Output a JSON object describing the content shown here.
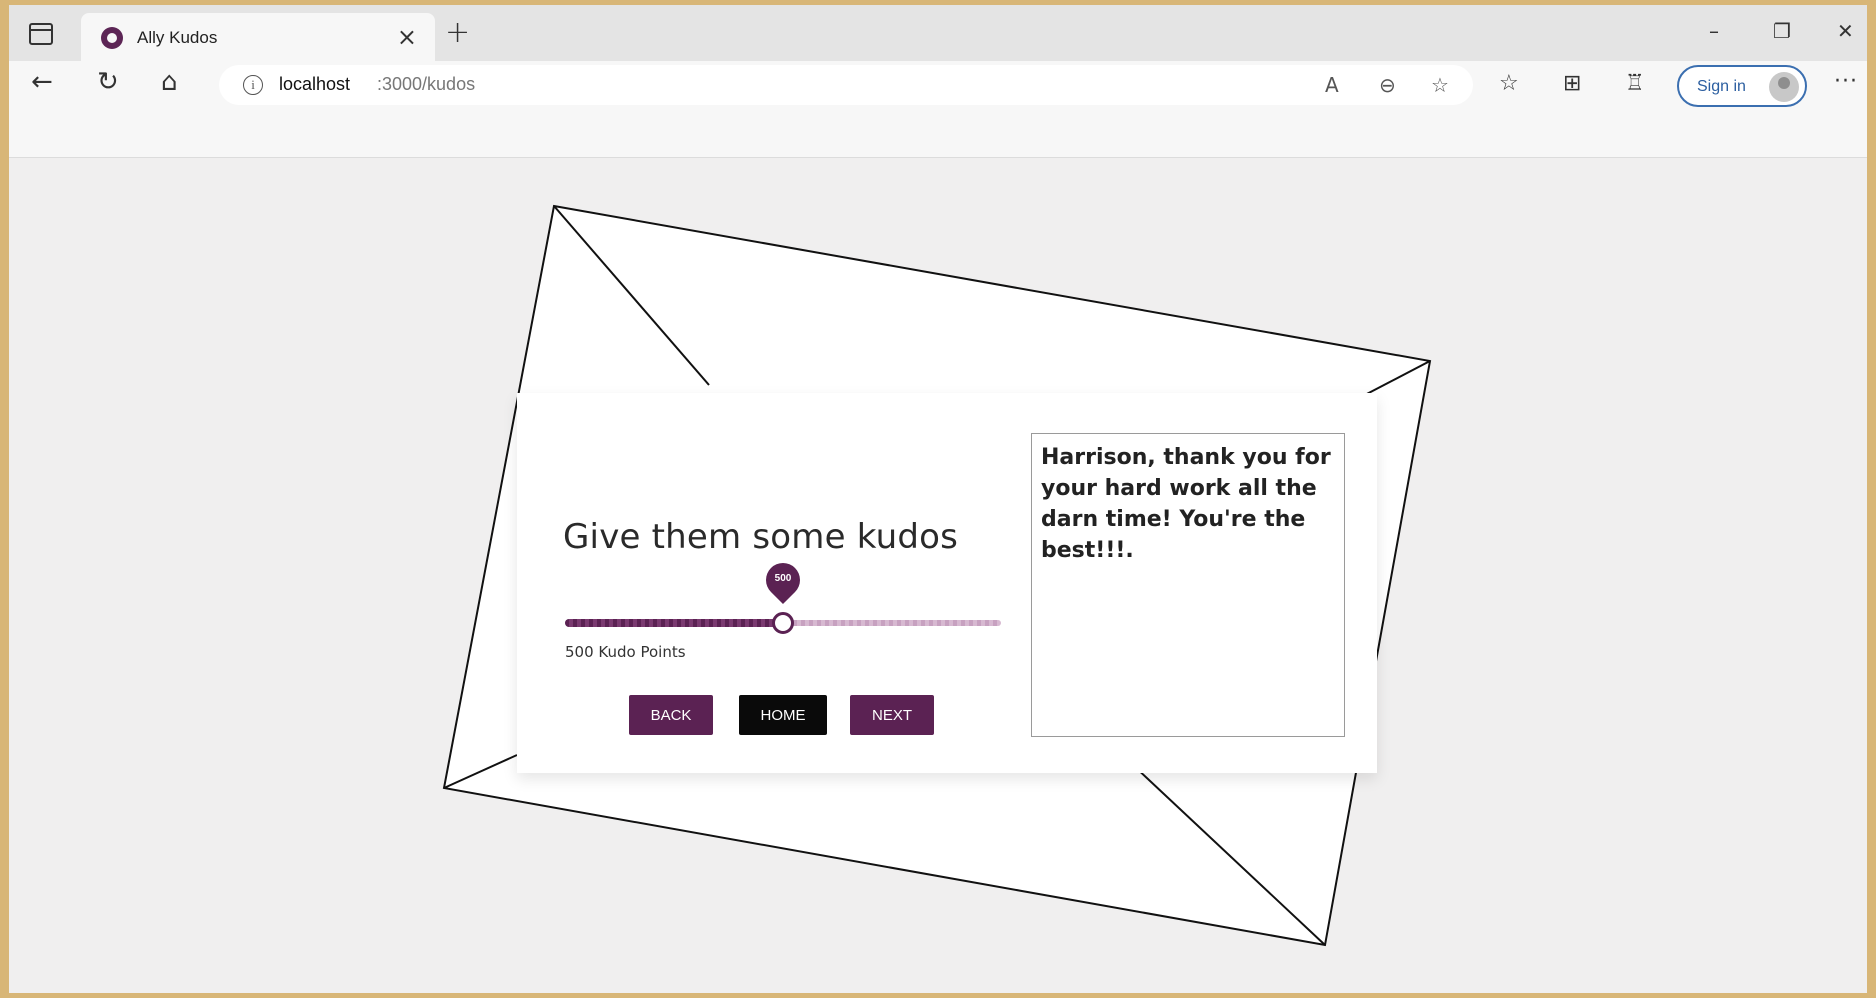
{
  "browser": {
    "tab": {
      "title": "Ally Kudos",
      "close_glyph": "×",
      "favicon": "ally-logo-icon"
    },
    "new_tab_glyph": "+",
    "window_controls": {
      "minimize": "–",
      "restore": "❐",
      "close": "✕"
    },
    "nav": {
      "back": "←",
      "refresh": "↻",
      "home": "⌂"
    },
    "address": {
      "host": "localhost",
      "path": ":3000/kudos",
      "info_glyph": "i"
    },
    "address_icons": {
      "read_aloud": "A",
      "zoom": "⊖",
      "add_favorite": "☆"
    },
    "toolbar_icons": {
      "favorites": "☆",
      "collections": "⊞",
      "extensions": "♖"
    },
    "signin_label": "Sign in",
    "more_glyph": "···"
  },
  "kudos": {
    "heading": "Give them some kudos",
    "slider": {
      "value": 500,
      "min": 0,
      "max": 1000,
      "bubble_label": "500"
    },
    "points_label": "500 Kudo Points",
    "buttons": {
      "back": "BACK",
      "home": "HOME",
      "next": "NEXT"
    },
    "message": "Harrison, thank you for your hard work all the darn time! You're the best!!!."
  },
  "colors": {
    "accent": "#5b2253",
    "home_button": "#0a0a0a",
    "page_background": "#f0efef",
    "outer_border": "#d8b677"
  }
}
